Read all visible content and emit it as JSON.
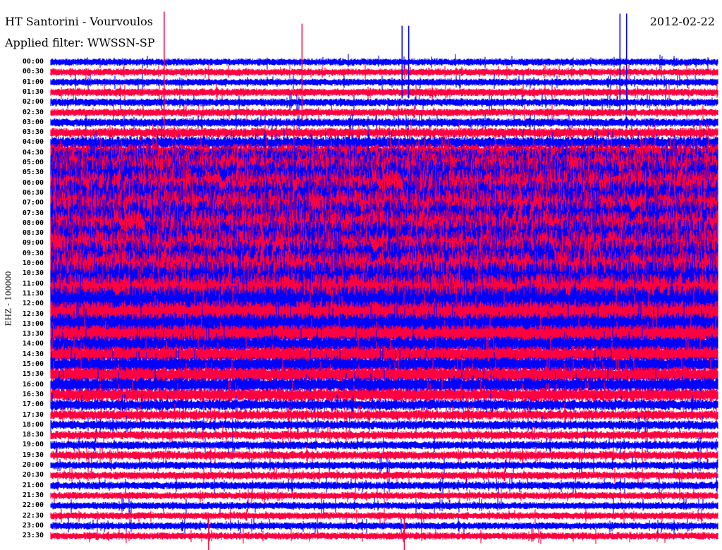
{
  "header": {
    "title": "HT Santorini - Vourvoulos",
    "filter": "Applied filter: WWSSN-SP",
    "date": "2012-02-22"
  },
  "chart_data": {
    "type": "line",
    "title": "HT Santorini - Vourvoulos",
    "subtitle": "Applied filter: WWSSN-SP",
    "date": "2012-02-22",
    "ylabel": "EHZ - 100000",
    "minutes_per_row": 30,
    "row_colors": [
      "#0000ff",
      "#ff0040"
    ],
    "rows": [
      "00:00",
      "00:30",
      "01:00",
      "01:30",
      "02:00",
      "02:30",
      "03:00",
      "03:30",
      "04:00",
      "04:30",
      "05:00",
      "05:30",
      "06:00",
      "06:30",
      "07:00",
      "07:30",
      "08:00",
      "08:30",
      "09:00",
      "09:30",
      "10:00",
      "10:30",
      "11:00",
      "11:30",
      "12:00",
      "12:30",
      "13:00",
      "13:30",
      "14:00",
      "14:30",
      "15:00",
      "15:30",
      "16:00",
      "16:30",
      "17:00",
      "17:30",
      "18:00",
      "18:30",
      "19:00",
      "19:30",
      "20:00",
      "20:30",
      "21:00",
      "21:30",
      "22:00",
      "22:30",
      "23:00",
      "23:30"
    ],
    "relative_activity": [
      0.6,
      0.6,
      0.6,
      0.65,
      0.65,
      0.65,
      0.7,
      0.8,
      1.0,
      1.5,
      2.5,
      3.5,
      4,
      4,
      4,
      4,
      4,
      4,
      4,
      4,
      4,
      4,
      3.8,
      3.5,
      3,
      2.2,
      1.8,
      1.6,
      1.4,
      1.4,
      1.3,
      1.3,
      1.2,
      1.1,
      0.9,
      0.8,
      0.75,
      0.7,
      0.7,
      0.7,
      0.65,
      0.65,
      0.65,
      0.6,
      0.6,
      0.6,
      0.6,
      0.6
    ],
    "events": [
      {
        "row": 1,
        "minute": 5.1,
        "amplitude": 10
      },
      {
        "row": 1,
        "minute": 11.3,
        "amplitude": 8
      },
      {
        "row": 0,
        "minute": 15.8,
        "amplitude": 6
      },
      {
        "row": 0,
        "minute": 16.1,
        "amplitude": 6
      },
      {
        "row": 0,
        "minute": 25.6,
        "amplitude": 8
      },
      {
        "row": 0,
        "minute": 25.9,
        "amplitude": 8
      },
      {
        "row": 47,
        "minute": 7.1,
        "amplitude": 3
      },
      {
        "row": 47,
        "minute": 15.9,
        "amplitude": 3
      }
    ]
  }
}
